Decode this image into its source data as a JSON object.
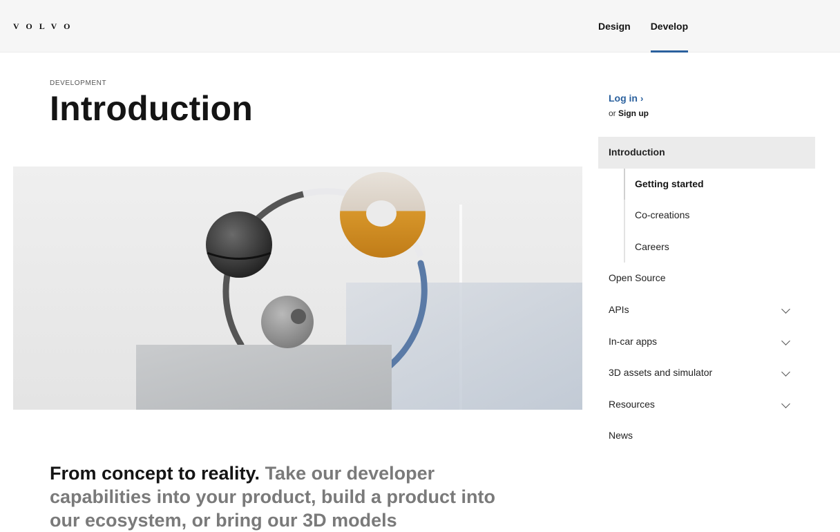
{
  "header": {
    "logo": "VOLVO",
    "nav": [
      {
        "label": "Design"
      },
      {
        "label": "Develop"
      }
    ]
  },
  "main": {
    "eyebrow": "DEVELOPMENT",
    "title": "Introduction",
    "lead_strong": "From concept to reality.",
    "lead_rest": " Take our developer capabilities into your product, build a product into our ecosystem, or bring our 3D models"
  },
  "sidebar": {
    "login_label": "Log in",
    "login_chevron": "›",
    "signup_prefix": "or ",
    "signup_label": "Sign up",
    "items": [
      {
        "label": "Introduction"
      },
      {
        "label": "Getting started"
      },
      {
        "label": "Co-creations"
      },
      {
        "label": "Careers"
      },
      {
        "label": "Open Source"
      },
      {
        "label": "APIs"
      },
      {
        "label": "In-car apps"
      },
      {
        "label": "3D assets and simulator"
      },
      {
        "label": "Resources"
      },
      {
        "label": "News"
      }
    ]
  },
  "colors": {
    "accent": "#2a609d",
    "header_bg": "#f6f6f6",
    "active_item_bg": "#ebebeb",
    "lead_gray": "#7a7a7a"
  }
}
